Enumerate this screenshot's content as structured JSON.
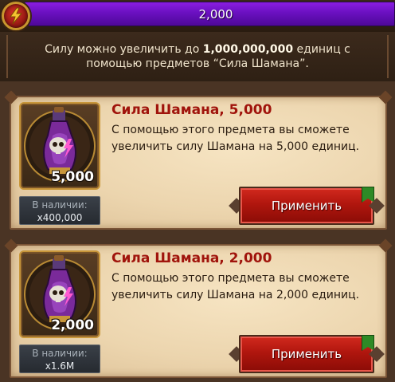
{
  "top_bar": {
    "value": "2,000",
    "icon": "lightning-icon"
  },
  "info": {
    "text_before": "Силу можно увеличить до ",
    "max_value": "1,000,000,000",
    "text_after": " единиц с помощью предметов “Сила Шамана”."
  },
  "items": [
    {
      "title": "Сила Шамана, 5,000",
      "description": "С помощью этого предмета вы сможете увеличить силу Шамана на 5,000 единиц.",
      "icon_value": "5,000",
      "stock_label": "В наличии:",
      "stock_value": "x400,000",
      "button_label": "Применить",
      "icon": "potion-icon"
    },
    {
      "title": "Сила Шамана, 2,000",
      "description": "С помощью этого предмета вы сможете увеличить силу Шамана на 2,000 единиц.",
      "icon_value": "2,000",
      "stock_label": "В наличии:",
      "stock_value": "x1.6M",
      "button_label": "Применить",
      "icon": "potion-icon"
    }
  ],
  "colors": {
    "energy_bar": "#6a10c0",
    "title_red": "#a0140c",
    "button_red": "#b0160e",
    "badge_green": "#2e8a26"
  }
}
